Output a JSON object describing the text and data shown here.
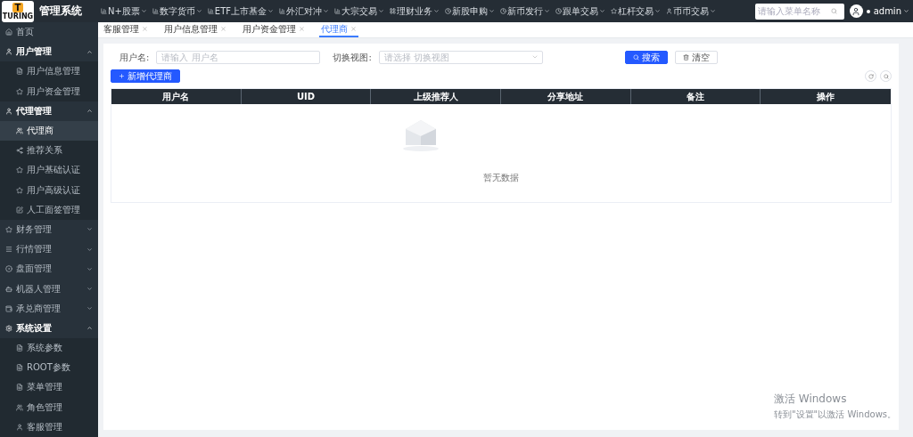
{
  "header": {
    "logo_letter": "T",
    "logo_text": "TURING",
    "title": "管理系统",
    "nav": [
      {
        "label": "N+股票"
      },
      {
        "label": "数字货币"
      },
      {
        "label": "ETF上市基金"
      },
      {
        "label": "外汇对冲"
      },
      {
        "label": "大宗交易"
      },
      {
        "label": "理财业务"
      },
      {
        "label": "新股申购"
      },
      {
        "label": "新币发行"
      },
      {
        "label": "跟单交易"
      },
      {
        "label": "杠杆交易"
      },
      {
        "label": "币币交易"
      }
    ],
    "search": {
      "placeholder": "请输入菜单名称"
    },
    "user": "admin"
  },
  "sidebar": {
    "items": [
      {
        "kind": "link",
        "label": "首页",
        "selected": false
      },
      {
        "kind": "group",
        "label": "用户管理",
        "expanded": true,
        "children": [
          {
            "label": "用户信息管理",
            "selected": false
          },
          {
            "label": "用户资金管理",
            "selected": false
          }
        ]
      },
      {
        "kind": "group",
        "label": "代理管理",
        "expanded": true,
        "children": [
          {
            "label": "代理商",
            "selected": true
          },
          {
            "label": "推荐关系",
            "selected": false
          },
          {
            "label": "用户基础认证",
            "selected": false
          },
          {
            "label": "用户高级认证",
            "selected": false
          },
          {
            "label": "人工面签管理",
            "selected": false
          }
        ]
      },
      {
        "kind": "group",
        "label": "财务管理",
        "expanded": false
      },
      {
        "kind": "group",
        "label": "行情管理",
        "expanded": false
      },
      {
        "kind": "group",
        "label": "盘面管理",
        "expanded": false
      },
      {
        "kind": "group",
        "label": "机器人管理",
        "expanded": false
      },
      {
        "kind": "group",
        "label": "承兑商管理",
        "expanded": false
      },
      {
        "kind": "group",
        "label": "系统设置",
        "expanded": true,
        "children": [
          {
            "label": "系统参数",
            "selected": false
          },
          {
            "label": "ROOT参数",
            "selected": false
          },
          {
            "label": "菜单管理",
            "selected": false
          },
          {
            "label": "角色管理",
            "selected": false
          },
          {
            "label": "客服管理",
            "selected": false
          }
        ]
      }
    ]
  },
  "tabs": [
    {
      "label": "客服管理",
      "selected": false
    },
    {
      "label": "用户信息管理",
      "selected": false
    },
    {
      "label": "用户资金管理",
      "selected": false
    },
    {
      "label": "代理商",
      "selected": true
    }
  ],
  "filters": [
    {
      "kind": "input",
      "label": "用户名:",
      "placeholder": "请输入 用户名"
    },
    {
      "kind": "select",
      "label": "切换视图:",
      "placeholder": "请选择 切换视图"
    }
  ],
  "buttons": [
    {
      "kind": "primary",
      "label": "搜索"
    },
    {
      "kind": "default",
      "label": "清空"
    }
  ],
  "add_button": "新增代理商",
  "table": {
    "columns": [
      "用户名",
      "UID",
      "上级推荐人",
      "分享地址",
      "备注",
      "操作"
    ],
    "empty_text": "暂无数据"
  },
  "os_overlay": {
    "title": "激活 Windows",
    "text": "转到\"设置\"以激活 Windows。"
  }
}
